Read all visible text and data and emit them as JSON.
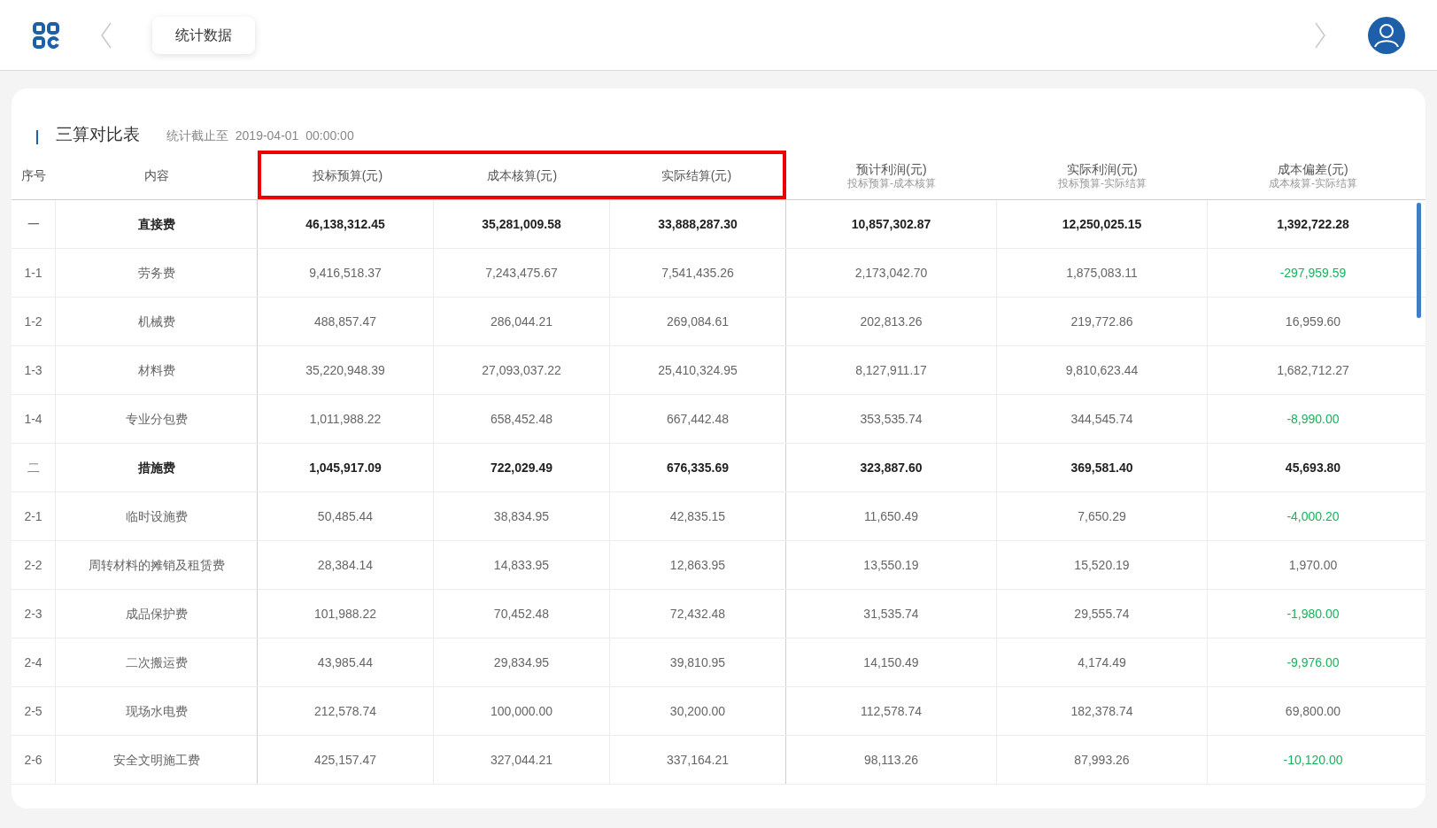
{
  "top_bar": {
    "tab": "统计数据"
  },
  "card": {
    "title": "三算对比表",
    "subtitle": "统计截止至  2019-04-01  00:00:00"
  },
  "table": {
    "columns": [
      {
        "label": "序号",
        "highlighted": false
      },
      {
        "label": "内容",
        "highlighted": false
      },
      {
        "label": "投标预算(元)",
        "highlighted": true
      },
      {
        "label": "成本核算(元)",
        "highlighted": true
      },
      {
        "label": "实际结算(元)",
        "highlighted": true
      },
      {
        "label": "预计利润(元)",
        "note": "投标预算-成本核算",
        "highlighted": false
      },
      {
        "label": "实际利润(元)",
        "note": "投标预算-实际结算",
        "highlighted": false
      },
      {
        "label": "成本偏差(元)",
        "note": "成本核算-实际结算",
        "highlighted": false
      }
    ],
    "rows": [
      {
        "kind": "group",
        "cells": [
          "一",
          "直接费",
          "46,138,312.45",
          "35,281,009.58",
          "33,888,287.30",
          "10,857,302.87",
          "12,250,025.15",
          "1,392,722.28"
        ],
        "negative": false
      },
      {
        "kind": "item",
        "cells": [
          "1-1",
          "劳务费",
          "9,416,518.37",
          "7,243,475.67",
          "7,541,435.26",
          "2,173,042.70",
          "1,875,083.11",
          "-297,959.59"
        ],
        "negative": true
      },
      {
        "kind": "item",
        "cells": [
          "1-2",
          "机械费",
          "488,857.47",
          "286,044.21",
          "269,084.61",
          "202,813.26",
          "219,772.86",
          "16,959.60"
        ],
        "negative": false
      },
      {
        "kind": "item",
        "cells": [
          "1-3",
          "材料费",
          "35,220,948.39",
          "27,093,037.22",
          "25,410,324.95",
          "8,127,911.17",
          "9,810,623.44",
          "1,682,712.27"
        ],
        "negative": false
      },
      {
        "kind": "item",
        "cells": [
          "1-4",
          "专业分包费",
          "1,011,988.22",
          "658,452.48",
          "667,442.48",
          "353,535.74",
          "344,545.74",
          "-8,990.00"
        ],
        "negative": true
      },
      {
        "kind": "group",
        "cells": [
          "二",
          "措施费",
          "1,045,917.09",
          "722,029.49",
          "676,335.69",
          "323,887.60",
          "369,581.40",
          "45,693.80"
        ],
        "negative": false
      },
      {
        "kind": "item",
        "cells": [
          "2-1",
          "临时设施费",
          "50,485.44",
          "38,834.95",
          "42,835.15",
          "11,650.49",
          "7,650.29",
          "-4,000.20"
        ],
        "negative": true
      },
      {
        "kind": "item",
        "cells": [
          "2-2",
          "周转材料的摊销及租赁费",
          "28,384.14",
          "14,833.95",
          "12,863.95",
          "13,550.19",
          "15,520.19",
          "1,970.00"
        ],
        "negative": false
      },
      {
        "kind": "item",
        "cells": [
          "2-3",
          "成品保护费",
          "101,988.22",
          "70,452.48",
          "72,432.48",
          "31,535.74",
          "29,555.74",
          "-1,980.00"
        ],
        "negative": true
      },
      {
        "kind": "item",
        "cells": [
          "2-4",
          "二次搬运费",
          "43,985.44",
          "29,834.95",
          "39,810.95",
          "14,150.49",
          "4,174.49",
          "-9,976.00"
        ],
        "negative": true
      },
      {
        "kind": "item",
        "cells": [
          "2-5",
          "现场水电费",
          "212,578.74",
          "100,000.00",
          "30,200.00",
          "112,578.74",
          "182,378.74",
          "69,800.00"
        ],
        "negative": false
      },
      {
        "kind": "item",
        "cells": [
          "2-6",
          "安全文明施工费",
          "425,157.47",
          "327,044.21",
          "337,164.21",
          "98,113.26",
          "87,993.26",
          "-10,120.00"
        ],
        "negative": true
      }
    ]
  }
}
